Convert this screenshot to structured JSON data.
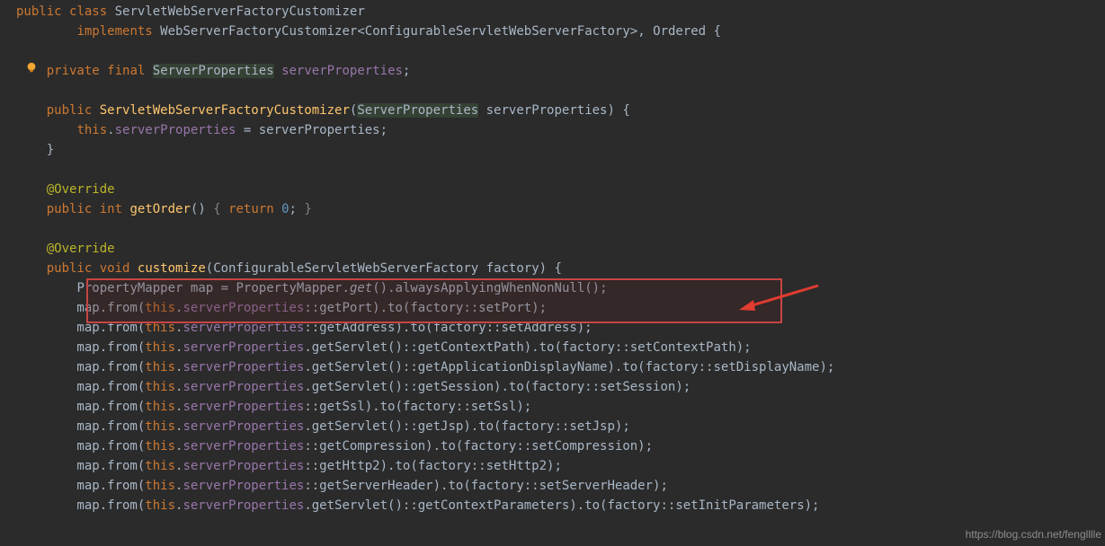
{
  "code": {
    "l1": {
      "kw1": "public",
      "kw2": "class",
      "name": "ServletWebServerFactoryCustomizer"
    },
    "l2": {
      "kw": "implements",
      "iface": "WebServerFactoryCustomizer",
      "lt": "<",
      "generic": "ConfigurableServletWebServerFactory",
      "gt": ">",
      "comma": ",",
      "ordered": "Ordered",
      "brace": "{"
    },
    "l4": {
      "kw1": "private",
      "kw2": "final",
      "type": "ServerProperties",
      "field": "serverProperties",
      "semi": ";"
    },
    "l6": {
      "kw": "public",
      "ctor": "ServletWebServerFactoryCustomizer",
      "lp": "(",
      "ptype": "ServerProperties",
      "pname": "serverProperties",
      "rp": ")",
      "brace": "{"
    },
    "l7": {
      "thiskw": "this",
      "dot": ".",
      "field": "serverProperties",
      "eq": " = ",
      "arg": "serverProperties",
      "semi": ";"
    },
    "l8": {
      "brace": "}"
    },
    "l10": {
      "anno": "@Override"
    },
    "l11": {
      "kw": "public",
      "rettype": "int",
      "name": "getOrder",
      "p": "()",
      "ob": "{",
      "ret": "return",
      "num": "0",
      "semi": ";",
      "cb": "}"
    },
    "l13": {
      "anno": "@Override"
    },
    "l14": {
      "kw": "public",
      "rettype": "void",
      "name": "customize",
      "lp": "(",
      "ptype": "ConfigurableServletWebServerFactory",
      "pname": "factory",
      "rp": ")",
      "brace": "{"
    },
    "l15": {
      "type": "PropertyMapper",
      "var": "map",
      "eq": " = ",
      "cls": "PropertyMapper",
      "dot": ".",
      "get": "get",
      "p": "()",
      "dot2": ".",
      "m2": "alwaysApplyingWhenNonNull",
      "p2": "()",
      "semi": ";"
    },
    "mapline": {
      "prefix": "        map.from(",
      "thiskw": "this",
      "dot": ".",
      "field": "serverProperties"
    },
    "r16": {
      "ref": "::getPort",
      "to": ").to(factory::setPort);"
    },
    "r17": {
      "ref": "::getAddress",
      "to": ").to(factory::setAddress);"
    },
    "r18": {
      "call": ".getServlet()::getContextPath",
      "to": ").to(factory::setContextPath);"
    },
    "r19": {
      "call": ".getServlet()::getApplicationDisplayName",
      "to": ").to(factory::setDisplayName);"
    },
    "r20": {
      "call": ".getServlet()::getSession",
      "to": ").to(factory::setSession);"
    },
    "r21": {
      "ref": "::getSsl",
      "to": ").to(factory::setSsl);"
    },
    "r22": {
      "call": ".getServlet()::getJsp",
      "to": ").to(factory::setJsp);"
    },
    "r23": {
      "ref": "::getCompression",
      "to": ").to(factory::setCompression);"
    },
    "r24": {
      "ref": "::getHttp2",
      "to": ").to(factory::setHttp2);"
    },
    "r25": {
      "ref": "::getServerHeader",
      "to": ").to(factory::setServerHeader);"
    },
    "r26": {
      "call": ".getServlet()::getContextParameters",
      "to": ").to(factory::setInitParameters);"
    }
  },
  "watermark": "https://blog.csdn.net/fenglllle"
}
